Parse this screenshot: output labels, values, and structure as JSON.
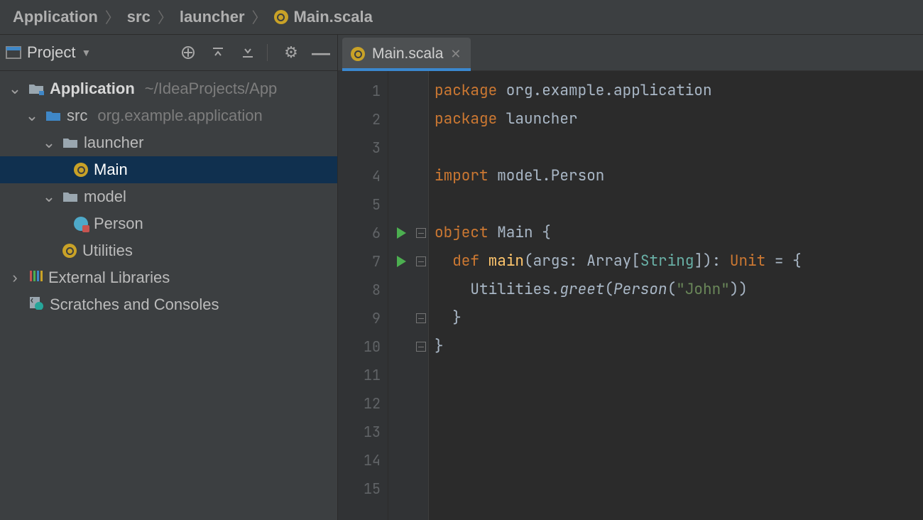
{
  "breadcrumbs": [
    {
      "label": "Application"
    },
    {
      "label": "src"
    },
    {
      "label": "launcher"
    },
    {
      "label": "Main.scala",
      "icon": "scala"
    }
  ],
  "sidebar": {
    "view_label": "Project",
    "tree": {
      "app": {
        "name": "Application",
        "path": "~/IdeaProjects/App"
      },
      "src": {
        "name": "src",
        "pkg": "org.example.application"
      },
      "launcher": {
        "name": "launcher"
      },
      "main": {
        "name": "Main"
      },
      "model": {
        "name": "model"
      },
      "person": {
        "name": "Person"
      },
      "utilities": {
        "name": "Utilities"
      },
      "ext": {
        "name": "External Libraries"
      },
      "scratch": {
        "name": "Scratches and Consoles"
      }
    }
  },
  "tab": {
    "label": "Main.scala"
  },
  "gutter": {
    "lines": 15,
    "run_markers": [
      6,
      7
    ],
    "fold_markers": [
      6,
      7,
      9,
      10
    ]
  },
  "code": {
    "l1": {
      "kw": "package",
      "rest": " org.example.application"
    },
    "l2": {
      "kw": "package",
      "rest": " launcher"
    },
    "l4": {
      "kw": "import",
      "rest": " model.Person"
    },
    "l6": {
      "kw": "object",
      "name": " Main ",
      "brace": "{"
    },
    "l7": {
      "def": "def",
      "fn": "main",
      "args_open": "(args: Array[",
      "str_ty": "String",
      "args_close": "]): ",
      "unit": "Unit",
      "tail": " = {"
    },
    "l8": {
      "pre": "    Utilities.",
      "greet": "greet",
      "open": "(",
      "person": "Person",
      "args": "(",
      "strv": "\"John\"",
      "close": "))"
    },
    "l9": "  }",
    "l10": "}"
  }
}
